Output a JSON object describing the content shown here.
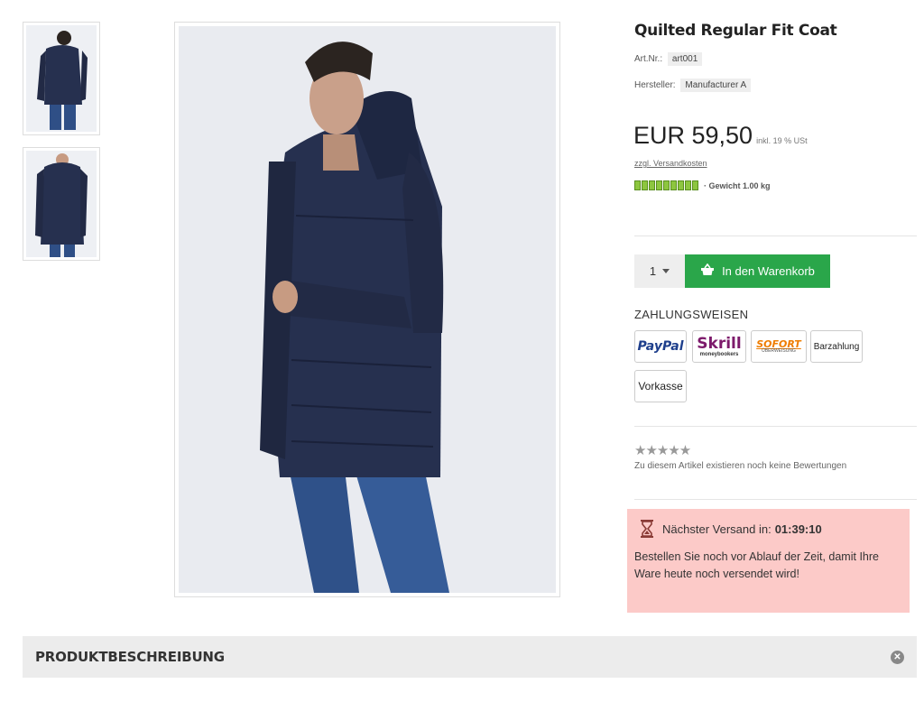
{
  "product": {
    "title": "Quilted Regular Fit Coat",
    "art_label": "Art.Nr.:",
    "art_value": "art001",
    "mfr_label": "Hersteller:",
    "mfr_value": "Manufacturer A",
    "price": "EUR 59,50",
    "tax_note": "inkl. 19 % USt",
    "shipping_link": "zzgl. Versandkosten",
    "weight_text": "· Gewicht 1.00 kg",
    "stock_level": 9
  },
  "cart": {
    "quantity": "1",
    "add_label": "In den Warenkorb"
  },
  "payment": {
    "title": "ZAHLUNGSWEISEN",
    "methods": [
      {
        "label": "PayPal"
      },
      {
        "label": "Skrill",
        "sub": "moneybookers"
      },
      {
        "label": "SOFORT",
        "sub": "ÜBERWEISUNG"
      },
      {
        "label": "Barzahlung"
      },
      {
        "label": "Vorkasse"
      }
    ]
  },
  "reviews": {
    "stars": "★★★★★",
    "empty_text": "Zu diesem Artikel existieren noch keine Bewertungen"
  },
  "shipping_countdown": {
    "label": "Nächster Versand in:",
    "time": "01:39:10",
    "message": "Bestellen Sie noch vor Ablauf der Zeit, damit Ihre Ware heute noch versendet wird!"
  },
  "description": {
    "title": "PRODUKTBESCHREIBUNG"
  },
  "colors": {
    "accent_green": "#2aa64a",
    "countdown_bg": "#fccac8",
    "coat_navy": "#26304f"
  }
}
